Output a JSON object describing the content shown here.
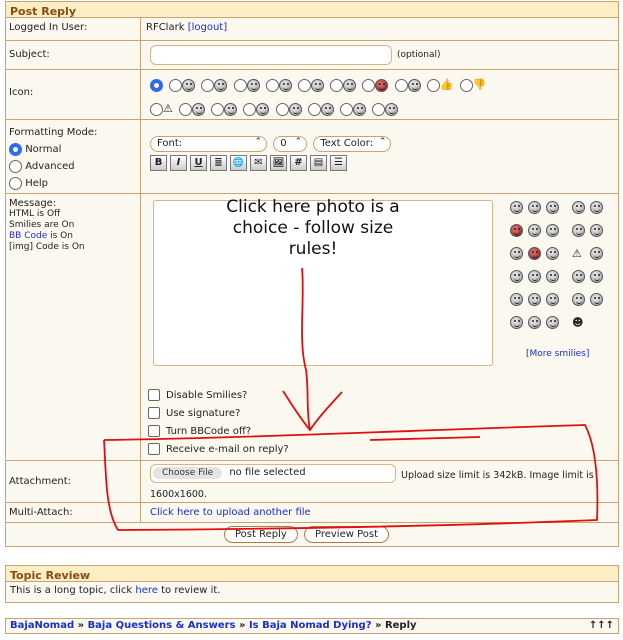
{
  "post_reply": {
    "header": "Post Reply",
    "logged_in": {
      "label": "Logged In User:",
      "user": "RFClark",
      "logout": "[logout]"
    },
    "subject": {
      "label": "Subject:",
      "value": "",
      "optional": "(optional)"
    },
    "icon": {
      "label": "Icon:"
    },
    "formatting": {
      "label": "Formatting Mode:",
      "modes": [
        "Normal",
        "Advanced",
        "Help"
      ],
      "font": "Font:",
      "size": "0",
      "text_color": "Text Color:",
      "toolbar": [
        "B",
        "I",
        "U",
        "≣",
        "🌐",
        "✉",
        "🖼",
        "#",
        "▤",
        "☰"
      ]
    },
    "message": {
      "label": "Message:",
      "html": "HTML is Off",
      "smilies": "Smilies are On",
      "bbcode_link": "BB Code",
      "bbcode_rest": " is On",
      "img": "[img] Code is On",
      "value": "",
      "more_smilies": "[More smilies]"
    },
    "options": [
      "Disable Smilies?",
      "Use signature?",
      "Turn BBCode off?",
      "Receive e-mail on reply?"
    ],
    "attachment": {
      "label": "Attachment:",
      "choose": "Choose File",
      "no_file": "no file selected",
      "limit": "Upload size limit is 342kB. Image limit is 1600x1600."
    },
    "multi_attach": {
      "label": "Multi-Attach:",
      "link": "Click here to upload another file"
    },
    "buttons": {
      "post": "Post Reply",
      "preview": "Preview Post"
    }
  },
  "topic_review": {
    "header": "Topic Review",
    "text_before": "This is a long topic, click ",
    "link": "here",
    "text_after": " to review it."
  },
  "breadcrumb": {
    "items": [
      "BajaNomad",
      "Baja Questions & Answers",
      "Is Baja Nomad Dying?"
    ],
    "current": "Reply",
    "sep": " » ",
    "arrows": "↑↑↑"
  },
  "annotation": {
    "text": "Click here photo is a choice - follow size rules!",
    "color": "#e01010"
  },
  "colors": {
    "border": "#c8a374",
    "header_bg": "#fbeec5",
    "header_text": "#8a4a10",
    "link": "#1a2fd0",
    "radio_on": "#2d6cf0"
  }
}
